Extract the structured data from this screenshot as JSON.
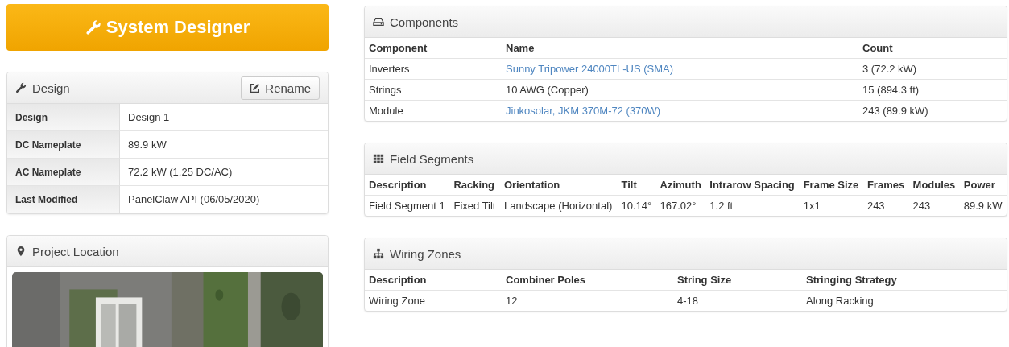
{
  "header_button": {
    "label": "System Designer"
  },
  "design_panel": {
    "title": "Design",
    "rename_button": "Rename",
    "rows": [
      {
        "label": "Design",
        "value": "Design 1"
      },
      {
        "label": "DC Nameplate",
        "value": "89.9 kW"
      },
      {
        "label": "AC Nameplate",
        "value": "72.2 kW (1.25 DC/AC)"
      },
      {
        "label": "Last Modified",
        "value": "PanelClaw API (06/05/2020)"
      }
    ]
  },
  "location_panel": {
    "title": "Project Location"
  },
  "components_panel": {
    "title": "Components",
    "columns": [
      "Component",
      "Name",
      "Count"
    ],
    "rows": [
      {
        "component": "Inverters",
        "name": "Sunny Tripower 24000TL-US (SMA)",
        "name_is_link": true,
        "count": "3 (72.2 kW)"
      },
      {
        "component": "Strings",
        "name": "10 AWG (Copper)",
        "name_is_link": false,
        "count": "15 (894.3 ft)"
      },
      {
        "component": "Module",
        "name": "Jinkosolar, JKM 370M-72 (370W)",
        "name_is_link": true,
        "count": "243 (89.9 kW)"
      }
    ]
  },
  "field_segments_panel": {
    "title": "Field Segments",
    "columns": [
      "Description",
      "Racking",
      "Orientation",
      "Tilt",
      "Azimuth",
      "Intrarow Spacing",
      "Frame Size",
      "Frames",
      "Modules",
      "Power"
    ],
    "rows": [
      [
        "Field Segment 1",
        "Fixed Tilt",
        "Landscape (Horizontal)",
        "10.14°",
        "167.02°",
        "1.2 ft",
        "1x1",
        "243",
        "243",
        "89.9 kW"
      ]
    ]
  },
  "wiring_zones_panel": {
    "title": "Wiring Zones",
    "columns": [
      "Description",
      "Combiner Poles",
      "String Size",
      "Stringing Strategy"
    ],
    "rows": [
      [
        "Wiring Zone",
        "12",
        "4-18",
        "Along Racking"
      ]
    ]
  }
}
